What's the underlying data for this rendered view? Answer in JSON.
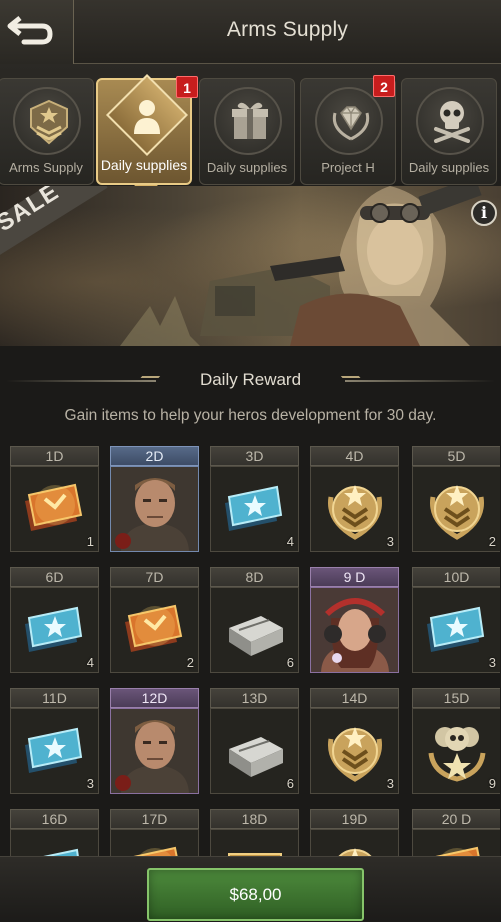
{
  "header": {
    "title": "Arms Supply",
    "back_icon": "back-arrow-icon"
  },
  "tabs": [
    {
      "label": "Arms Supply",
      "icon": "rank-emblem-icon",
      "active": false,
      "badge": ""
    },
    {
      "label": "Daily supplies",
      "icon": "person-icon",
      "active": true,
      "badge": "1"
    },
    {
      "label": "Daily supplies",
      "icon": "gift-icon",
      "active": false,
      "badge": ""
    },
    {
      "label": "Project H",
      "icon": "diamond-laurel-icon",
      "active": false,
      "badge": "2"
    },
    {
      "label": "Daily supplies",
      "icon": "skull-crossbones-icon",
      "active": false,
      "badge": ""
    }
  ],
  "banner": {
    "sale_text": "SALE",
    "info_label": "i"
  },
  "section": {
    "title": "Daily Reward",
    "subtitle": "Gain items to help your heros development for 30 day."
  },
  "rewards": [
    {
      "day": "1D",
      "item": "gold-ticket",
      "qty": "1",
      "style": "normal"
    },
    {
      "day": "2D",
      "item": "hero-portrait",
      "qty": "",
      "style": "hero"
    },
    {
      "day": "3D",
      "item": "blue-ticket",
      "qty": "4",
      "style": "normal"
    },
    {
      "day": "4D",
      "item": "rank-medal",
      "qty": "3",
      "style": "normal"
    },
    {
      "day": "5D",
      "item": "rank-medal",
      "qty": "2",
      "style": "normal"
    },
    {
      "day": "6D",
      "item": "blue-ticket",
      "qty": "4",
      "style": "normal"
    },
    {
      "day": "7D",
      "item": "gold-ticket",
      "qty": "2",
      "style": "normal"
    },
    {
      "day": "8D",
      "item": "silver-crate",
      "qty": "6",
      "style": "normal"
    },
    {
      "day": "9 D",
      "item": "heroine-portrait",
      "qty": "",
      "style": "purple"
    },
    {
      "day": "10D",
      "item": "blue-ticket",
      "qty": "3",
      "style": "normal"
    },
    {
      "day": "11D",
      "item": "blue-ticket",
      "qty": "3",
      "style": "normal"
    },
    {
      "day": "12D",
      "item": "hero-portrait",
      "qty": "",
      "style": "purple"
    },
    {
      "day": "13D",
      "item": "silver-crate",
      "qty": "6",
      "style": "normal"
    },
    {
      "day": "14D",
      "item": "rank-medal",
      "qty": "3",
      "style": "normal"
    },
    {
      "day": "15D",
      "item": "skull-medal",
      "qty": "9",
      "style": "normal"
    },
    {
      "day": "16D",
      "item": "blue-ticket",
      "qty": "",
      "style": "normal"
    },
    {
      "day": "17D",
      "item": "gold-ticket",
      "qty": "",
      "style": "normal"
    },
    {
      "day": "18D",
      "item": "gold-crate",
      "qty": "",
      "style": "normal"
    },
    {
      "day": "19D",
      "item": "rank-medal",
      "qty": "",
      "style": "normal"
    },
    {
      "day": "20 D",
      "item": "gold-ticket",
      "qty": "",
      "style": "normal"
    }
  ],
  "purchase": {
    "price_label": "$68,00"
  },
  "colors": {
    "accent_gold": "#e9cb86",
    "buy_green": "#4d8a3c",
    "badge_red": "#c71d1d",
    "hero_blue": "#576a88",
    "epic_purple": "#6a5579"
  }
}
